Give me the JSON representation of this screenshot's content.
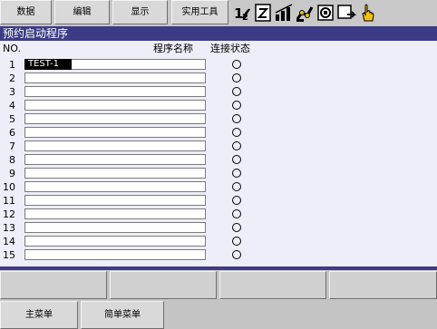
{
  "menu": {
    "items": [
      {
        "label": "数据"
      },
      {
        "label": "编辑"
      },
      {
        "label": "显示"
      },
      {
        "label": "实用工具"
      }
    ]
  },
  "toolbar_icons": [
    "number-toggle-icon",
    "edit-mode-icon",
    "chart-bars-icon",
    "robot-arm-icon",
    "io-panel-icon",
    "monitor-arrow-icon",
    "hand-pointer-icon"
  ],
  "screen": {
    "title": "预约启动程序",
    "col_no": "NO.",
    "col_program": "程序名称",
    "col_status": "连接状态"
  },
  "rows": [
    {
      "no": "1",
      "program": "TEST-1"
    },
    {
      "no": "2",
      "program": ""
    },
    {
      "no": "3",
      "program": ""
    },
    {
      "no": "4",
      "program": ""
    },
    {
      "no": "5",
      "program": ""
    },
    {
      "no": "6",
      "program": ""
    },
    {
      "no": "7",
      "program": ""
    },
    {
      "no": "8",
      "program": ""
    },
    {
      "no": "9",
      "program": ""
    },
    {
      "no": "10",
      "program": ""
    },
    {
      "no": "11",
      "program": ""
    },
    {
      "no": "12",
      "program": ""
    },
    {
      "no": "13",
      "program": ""
    },
    {
      "no": "14",
      "program": ""
    },
    {
      "no": "15",
      "program": ""
    }
  ],
  "function_keys": [
    "",
    "",
    "",
    ""
  ],
  "bottom": {
    "main_menu": "主菜单",
    "simple_menu": "简单菜单"
  },
  "colors": {
    "title_bg": "#3c3c86",
    "content_bg": "#eeeef8",
    "button_bg": "#d9d9d9"
  }
}
